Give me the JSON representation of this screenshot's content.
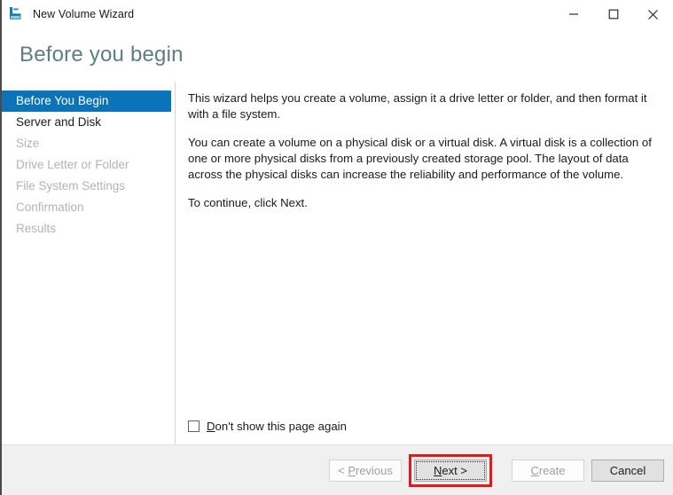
{
  "window": {
    "title": "New Volume Wizard",
    "icon": "volume-wizard-icon",
    "controls": {
      "minimize": "minimize-icon",
      "maximize": "maximize-icon",
      "close": "close-icon"
    }
  },
  "header": {
    "title": "Before you begin"
  },
  "nav": {
    "items": [
      {
        "label": "Before You Begin",
        "state": "selected"
      },
      {
        "label": "Server and Disk",
        "state": "enabled"
      },
      {
        "label": "Size",
        "state": "disabled"
      },
      {
        "label": "Drive Letter or Folder",
        "state": "disabled"
      },
      {
        "label": "File System Settings",
        "state": "disabled"
      },
      {
        "label": "Confirmation",
        "state": "disabled"
      },
      {
        "label": "Results",
        "state": "disabled"
      }
    ]
  },
  "content": {
    "paragraph1": "This wizard helps you create a volume, assign it a drive letter or folder, and then format it with a file system.",
    "paragraph2": "You can create a volume on a physical disk or a virtual disk. A virtual disk is a collection of one or more physical disks from a previously created storage pool. The layout of data across the physical disks can increase the reliability and performance of the volume.",
    "paragraph3": "To continue, click Next.",
    "checkbox": {
      "label_prefix": "",
      "accelerator": "D",
      "label_rest": "on't show this page again",
      "checked": false
    }
  },
  "footer": {
    "buttons": [
      {
        "name": "previous-button",
        "prefix": "< ",
        "accelerator": "P",
        "rest": "revious",
        "state": "disabled",
        "highlighted": false
      },
      {
        "name": "next-button",
        "prefix": "",
        "accelerator": "N",
        "rest": "ext >",
        "state": "focused",
        "highlighted": true
      },
      {
        "name": "create-button",
        "prefix": "",
        "accelerator": "C",
        "rest": "reate",
        "state": "disabled",
        "highlighted": false
      },
      {
        "name": "cancel-button",
        "prefix": "",
        "accelerator": "",
        "rest": "Cancel",
        "state": "enabled",
        "highlighted": false
      }
    ]
  },
  "colors": {
    "accent_blue": "#0d73b8",
    "header_text": "#5d7e84",
    "highlight_red": "#e01b1b",
    "footer_bg": "#f0f0f0",
    "disabled_text": "#b3b3b3"
  }
}
